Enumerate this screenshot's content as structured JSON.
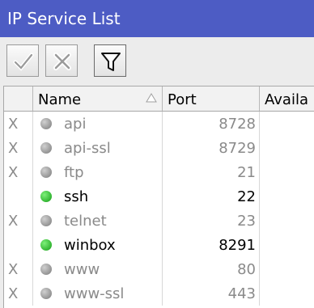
{
  "window": {
    "title": "IP Service List"
  },
  "toolbar": {
    "enable_icon": "checkmark-icon",
    "disable_icon": "x-icon",
    "filter_icon": "filter-icon"
  },
  "table": {
    "columns": [
      {
        "label": ""
      },
      {
        "label": "Name"
      },
      {
        "label": "Port"
      },
      {
        "label": "Availa"
      }
    ],
    "rows": [
      {
        "flag": "X",
        "name": "api",
        "port": "8728",
        "status": "disabled"
      },
      {
        "flag": "X",
        "name": "api-ssl",
        "port": "8729",
        "status": "disabled"
      },
      {
        "flag": "X",
        "name": "ftp",
        "port": "21",
        "status": "disabled"
      },
      {
        "flag": "",
        "name": "ssh",
        "port": "22",
        "status": "enabled"
      },
      {
        "flag": "X",
        "name": "telnet",
        "port": "23",
        "status": "disabled"
      },
      {
        "flag": "",
        "name": "winbox",
        "port": "8291",
        "status": "enabled"
      },
      {
        "flag": "X",
        "name": "www",
        "port": "80",
        "status": "disabled"
      },
      {
        "flag": "X",
        "name": "www-ssl",
        "port": "443",
        "status": "disabled"
      }
    ]
  },
  "colors": {
    "titlebar": "#4d5cc4",
    "enabled_dot": "#22c022",
    "disabled_dot": "#9a9a9a"
  }
}
